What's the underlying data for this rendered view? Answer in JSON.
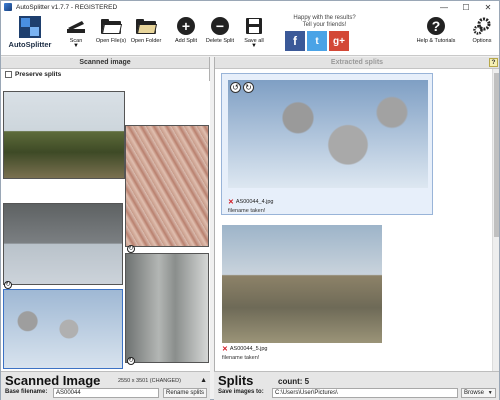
{
  "window": {
    "title": "AutoSplitter v1.7.7 - REGISTERED",
    "controls": {
      "minimize": "—",
      "maximize": "☐",
      "close": "✕"
    }
  },
  "toolbar": {
    "logo_text": "AutoSplitter",
    "scan_label": "Scan",
    "open_files_label": "Open File(s)",
    "open_folder_label": "Open Folder",
    "add_split_label": "Add Split",
    "delete_split_label": "Delete Split",
    "save_all_label": "Save all",
    "happy_line1": "Happy with the results?",
    "happy_line2": "Tell your friends!",
    "social": {
      "facebook": "f",
      "twitter": "t",
      "google": "g+"
    },
    "help_label": "Help & Tutorials",
    "options_label": "Options",
    "dropdown_arrow": "▼"
  },
  "left_pane": {
    "header": "Scanned image",
    "help_badge": "?",
    "preserve_label": "Preserve splits",
    "footer_title": "Scanned Image",
    "dimensions": "2550 x 3501 (CHANGED)",
    "collapse_arrow": "▲",
    "base_filename_label": "Base filename:",
    "base_filename_value": "AS00044",
    "rename_button": "Rename splits"
  },
  "right_pane": {
    "header": "Extracted splits",
    "help_badge": "?",
    "splits": [
      {
        "filename": "AS00044_4.jpg",
        "note": "filename taken!"
      },
      {
        "filename": "AS00044_5.jpg",
        "note": "filename taken!"
      }
    ],
    "footer_title": "Splits",
    "count_text": "count: 5",
    "save_label": "Save images to:",
    "save_path": "C:\\Users\\User\\Pictures\\",
    "browse_label": "Browse"
  },
  "colors": {
    "accent_blue": "#99b4d8",
    "error_red": "#d0121b",
    "facebook": "#3b5998",
    "twitter": "#4aa3e6",
    "google": "#d34836"
  }
}
